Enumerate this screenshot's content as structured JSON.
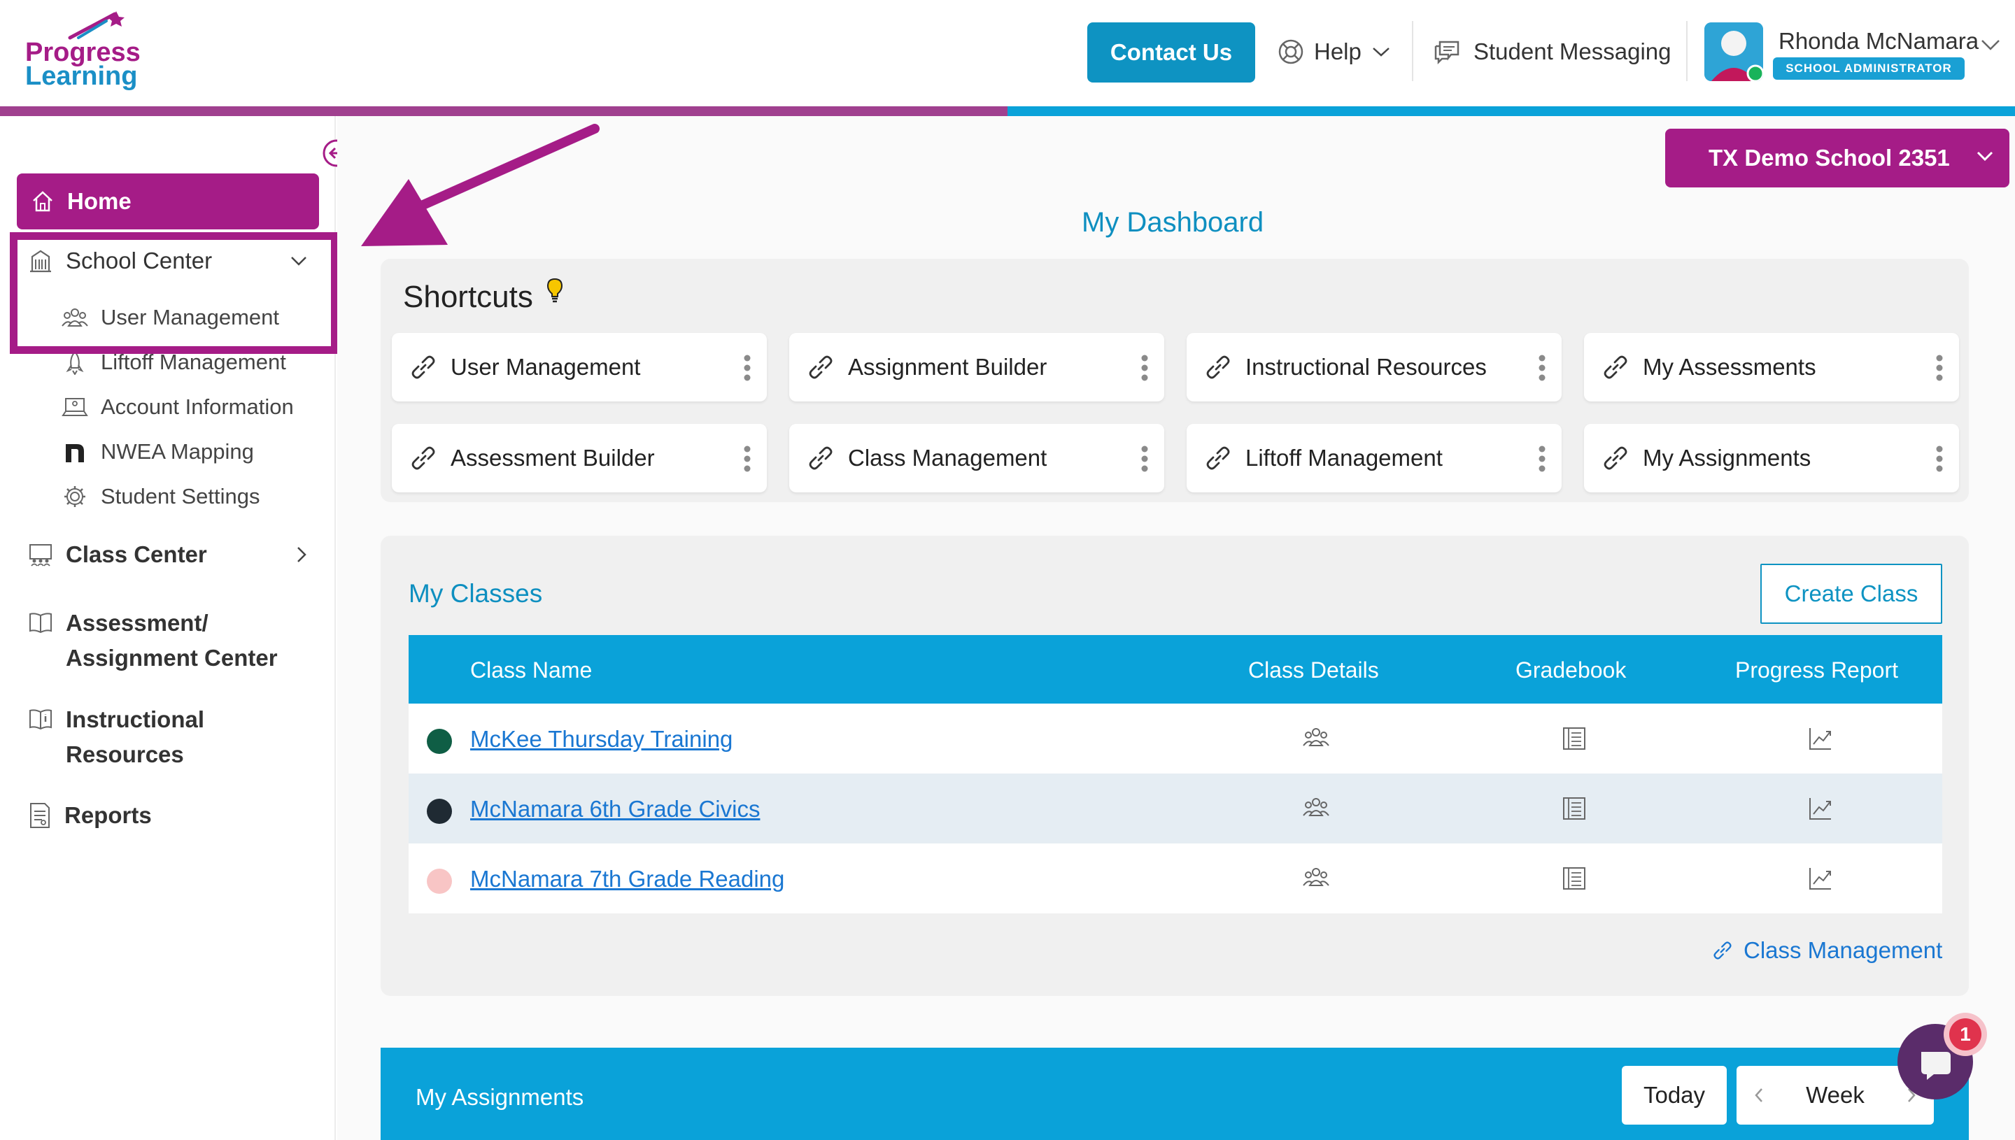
{
  "brand": {
    "line1": "Progress",
    "line2": "Learning",
    "purple": "#a51c87",
    "blue": "#0aa2d9"
  },
  "header": {
    "contact_label": "Contact Us",
    "help_label": "Help",
    "messaging_label": "Student Messaging",
    "user_name": "Rhonda McNamara",
    "user_role": "SCHOOL ADMINISTRATOR"
  },
  "sidebar": {
    "home": "Home",
    "school_center": "School Center",
    "school_sub": [
      "User Management",
      "Liftoff Management",
      "Account Information",
      "NWEA Mapping",
      "Student Settings"
    ],
    "class_center": "Class Center",
    "assessment_l1": "Assessment/",
    "assessment_l2": "Assignment Center",
    "instructional_l1": "Instructional",
    "instructional_l2": "Resources",
    "reports": "Reports"
  },
  "school_selector": "TX Demo School 2351",
  "dashboard_title": "My Dashboard",
  "shortcuts": {
    "title": "Shortcuts",
    "items": [
      "User Management",
      "Assignment Builder",
      "Instructional Resources",
      "My Assessments",
      "Assessment Builder",
      "Class Management",
      "Liftoff Management",
      "My Assignments"
    ]
  },
  "classes": {
    "title": "My Classes",
    "create_label": "Create Class",
    "columns": [
      "Class Name",
      "Class Details",
      "Gradebook",
      "Progress Report"
    ],
    "rows": [
      {
        "name": "McKee Thursday Training",
        "color": "#0f5e45"
      },
      {
        "name": "McNamara 6th Grade Civics",
        "color": "#1f2a33"
      },
      {
        "name": "McNamara 7th Grade Reading",
        "color": "#f8c5c5"
      }
    ],
    "manage_link": "Class Management"
  },
  "assignments": {
    "title": "My Assignments",
    "today_label": "Today",
    "week_label": "Week"
  },
  "chat": {
    "badge": "1"
  }
}
